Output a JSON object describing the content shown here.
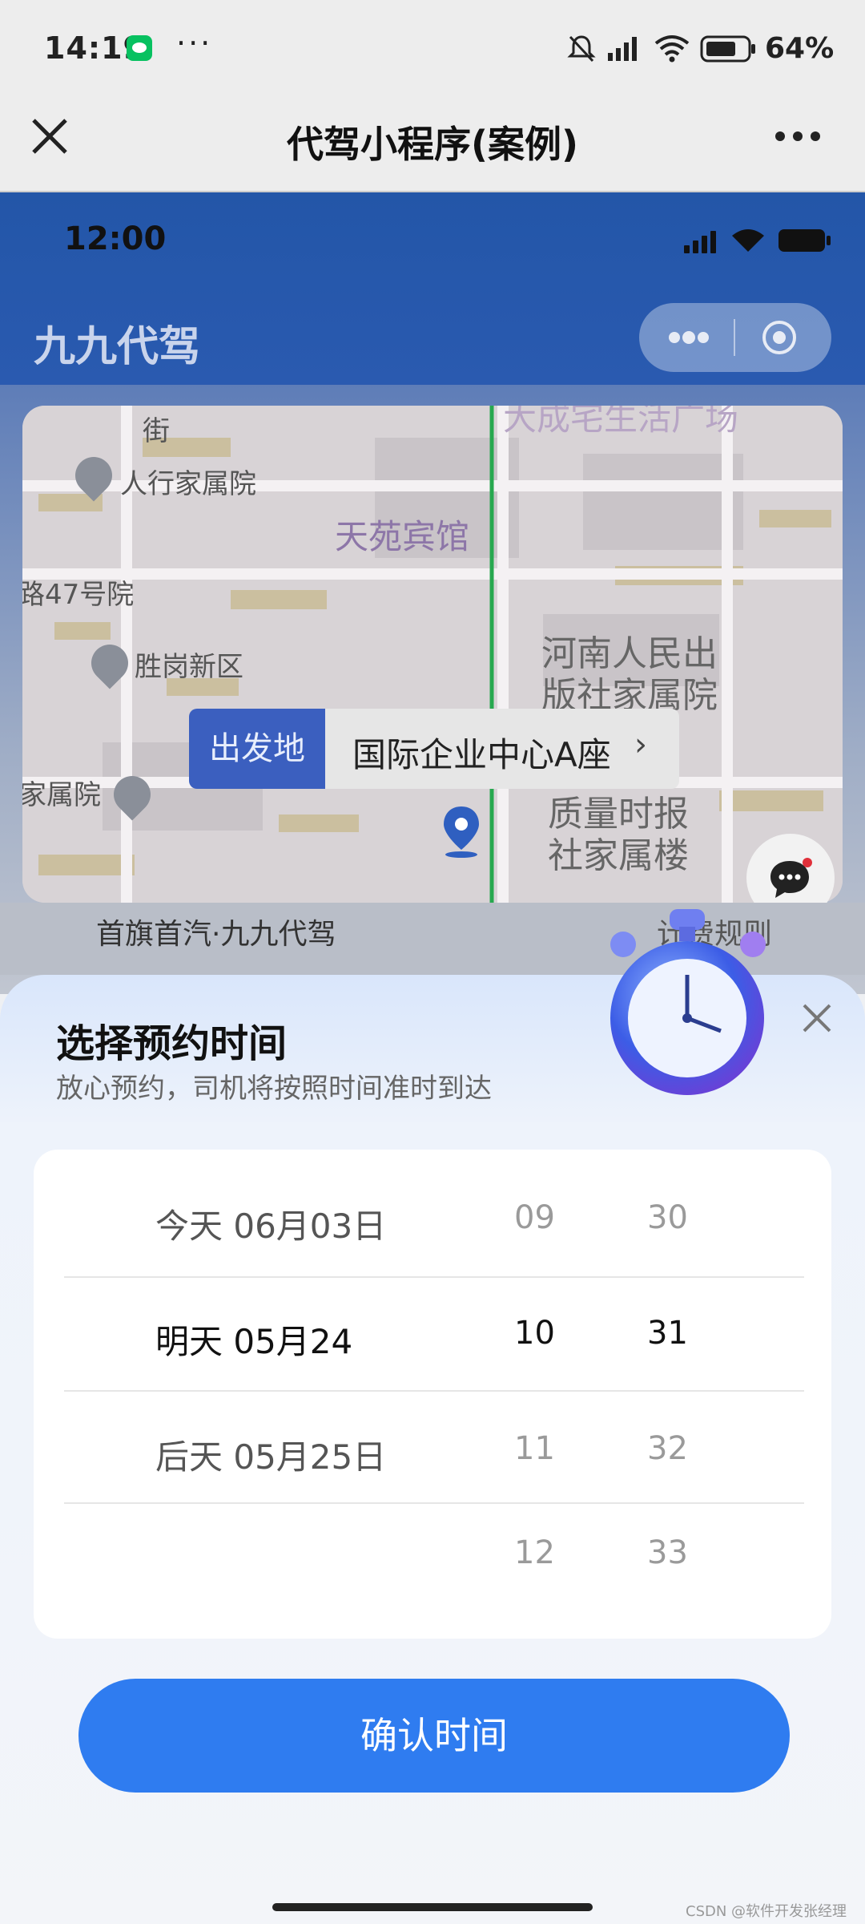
{
  "status_bar": {
    "time": "14:19",
    "more": "···",
    "battery": "64%"
  },
  "mini_nav": {
    "title": "代驾小程序(案例)"
  },
  "app": {
    "time": "12:00",
    "title": "九九代驾"
  },
  "map": {
    "labels": {
      "street": "街",
      "renhang": "人行家属院",
      "tianyuan": "天苑宾馆",
      "road47": "路47号院",
      "shenggang": "胜岗新区",
      "henan1": "河南人民出",
      "henan2": "版社家属院",
      "jiashuyuan": "家属院",
      "quality1": "质量时报",
      "quality2": "社家属楼",
      "top_cut": "大成宅生活广场"
    },
    "depart_tag": "出发地",
    "depart_addr": "国际企业中心A座",
    "depart_arrow": "›"
  },
  "route_strip": {
    "left": "首旗首汽·九九代驾",
    "right": "计费规则"
  },
  "sheet": {
    "title": "选择预约时间",
    "subtitle": "放心预约，司机将按照时间准时到达"
  },
  "picker": {
    "dates": [
      "今天  06月03日",
      "明天  05月24",
      "后天  05月25日",
      ""
    ],
    "hours": [
      "09",
      "10",
      "11",
      "12"
    ],
    "minutes": [
      "30",
      "31",
      "32",
      "33"
    ],
    "selected_index": 1
  },
  "confirm_label": "确认时间",
  "watermark": "CSDN @软件开发张经理",
  "colors": {
    "primary": "#2f7cf0",
    "header": "#2356a8",
    "depart_tag": "#3b5fbf"
  }
}
